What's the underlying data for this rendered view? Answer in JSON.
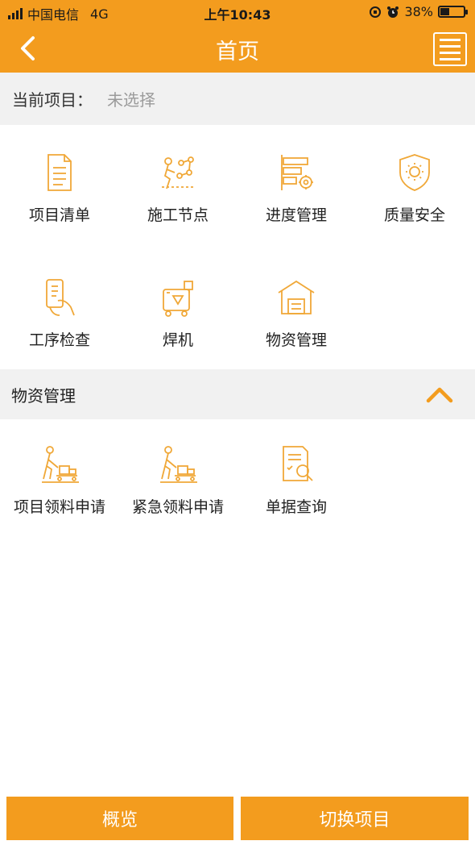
{
  "status_bar": {
    "carrier": "中国电信",
    "network": "4G",
    "time": "上午10:43",
    "battery": "38%",
    "battery_level": 0.38
  },
  "nav": {
    "title": "首页",
    "back_icon": "chevron-left-icon",
    "menu_icon": "list-menu-icon"
  },
  "project": {
    "label": "当前项目：",
    "value": "未选择"
  },
  "main_items": [
    {
      "label": "项目清单",
      "icon": "document-list-icon"
    },
    {
      "label": "施工节点",
      "icon": "construction-node-icon"
    },
    {
      "label": "进度管理",
      "icon": "progress-gear-icon"
    },
    {
      "label": "质量安全",
      "icon": "shield-sun-icon"
    },
    {
      "label": "工序检查",
      "icon": "phone-hand-icon"
    },
    {
      "label": "焊机",
      "icon": "welder-machine-icon"
    },
    {
      "label": "物资管理",
      "icon": "warehouse-icon"
    }
  ],
  "section": {
    "title": "物资管理",
    "toggle_icon": "chevron-up-icon"
  },
  "material_items": [
    {
      "label": "项目领料申请",
      "icon": "worker-cart-icon"
    },
    {
      "label": "紧急领料申请",
      "icon": "worker-cart-icon"
    },
    {
      "label": "单据查询",
      "icon": "document-search-icon"
    }
  ],
  "bottom": {
    "overview": "概览",
    "switch_project": "切换项目"
  },
  "colors": {
    "accent": "#f39c1e",
    "icon": "#f0a838",
    "section_bg": "#f1f1f1"
  }
}
